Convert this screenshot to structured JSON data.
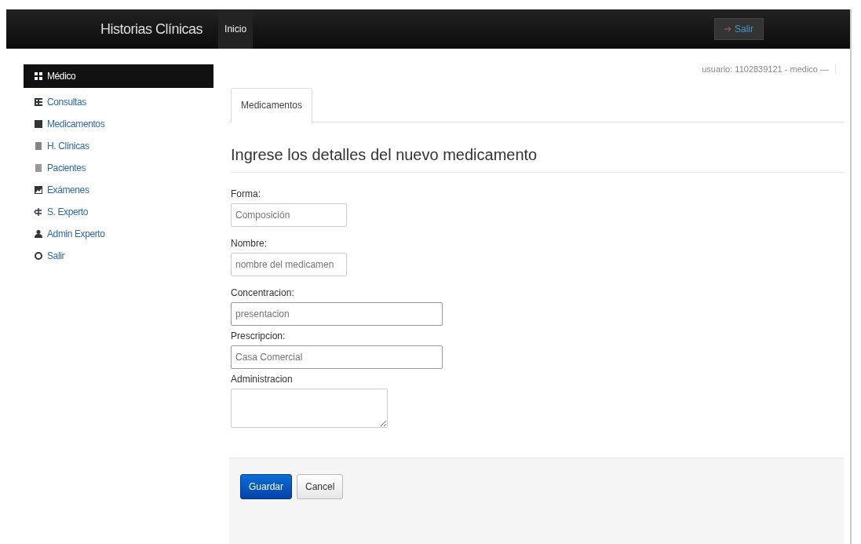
{
  "navbar": {
    "brand": "Historias Clínicas",
    "links": [
      {
        "label": "Inicio",
        "selected": true
      }
    ],
    "logout": "Salir"
  },
  "sidebar": {
    "items": [
      {
        "label": "Médico",
        "selected": true
      },
      {
        "label": "Consultas",
        "selected": false
      },
      {
        "label": "Medicamentos",
        "selected": false
      },
      {
        "label": "H. Clínicas",
        "selected": false
      },
      {
        "label": "Pacientes",
        "selected": false
      },
      {
        "label": "Exámenes",
        "selected": false
      },
      {
        "label": "S. Experto",
        "selected": false
      },
      {
        "label": "Admin Experto",
        "selected": false
      },
      {
        "label": "Salir",
        "selected": false
      }
    ]
  },
  "user_info": "usuario: 1102839121 - medico —",
  "tabs": [
    {
      "label": "Medicamentos",
      "selected": true
    }
  ],
  "heading": "Ingrese los detalles del nuevo medicamento",
  "form": {
    "fields": [
      {
        "kind": "short",
        "label": "Forma:",
        "placeholder": "Composición"
      },
      {
        "kind": "short",
        "label": "Nombre:",
        "placeholder": "nombre del medicamen"
      },
      {
        "kind": "long",
        "label": "Concentracion:",
        "placeholder": "presentacion"
      },
      {
        "kind": "long",
        "label": "Prescripcion:",
        "placeholder": "Casa Comercial"
      },
      {
        "kind": "textarea",
        "label": "Administracion"
      }
    ]
  },
  "buttons": [
    {
      "kind": "primary",
      "label": "Guardar"
    },
    {
      "kind": "default",
      "label": "Cancel"
    }
  ]
}
